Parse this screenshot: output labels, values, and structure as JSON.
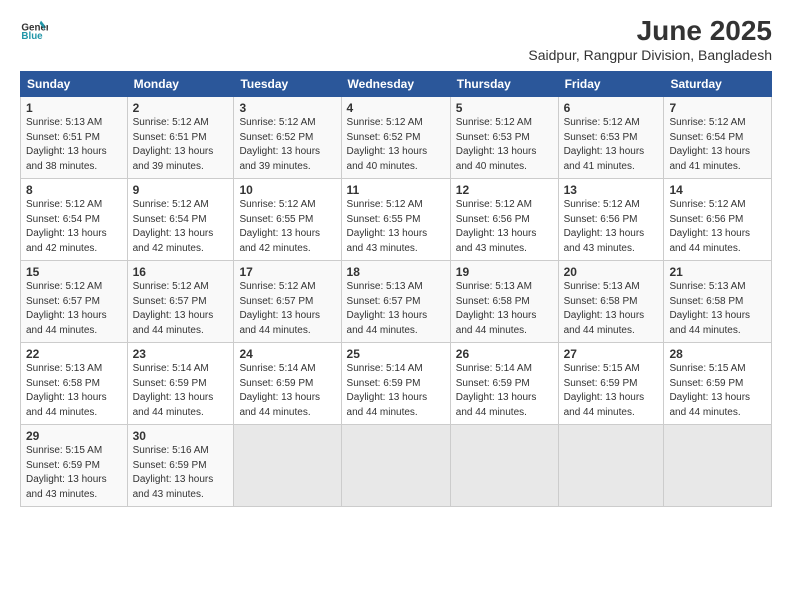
{
  "header": {
    "logo_line1": "General",
    "logo_line2": "Blue",
    "title": "June 2025",
    "subtitle": "Saidpur, Rangpur Division, Bangladesh"
  },
  "calendar": {
    "weekdays": [
      "Sunday",
      "Monday",
      "Tuesday",
      "Wednesday",
      "Thursday",
      "Friday",
      "Saturday"
    ],
    "weeks": [
      [
        {
          "day": "",
          "empty": true
        },
        {
          "day": "",
          "empty": true
        },
        {
          "day": "",
          "empty": true
        },
        {
          "day": "",
          "empty": true
        },
        {
          "day": "",
          "empty": true
        },
        {
          "day": "",
          "empty": true
        },
        {
          "day": "",
          "empty": true
        }
      ],
      [
        {
          "day": "1",
          "sunrise": "5:13 AM",
          "sunset": "6:51 PM",
          "daylight": "13 hours and 38 minutes."
        },
        {
          "day": "2",
          "sunrise": "5:12 AM",
          "sunset": "6:51 PM",
          "daylight": "13 hours and 39 minutes."
        },
        {
          "day": "3",
          "sunrise": "5:12 AM",
          "sunset": "6:52 PM",
          "daylight": "13 hours and 39 minutes."
        },
        {
          "day": "4",
          "sunrise": "5:12 AM",
          "sunset": "6:52 PM",
          "daylight": "13 hours and 40 minutes."
        },
        {
          "day": "5",
          "sunrise": "5:12 AM",
          "sunset": "6:53 PM",
          "daylight": "13 hours and 40 minutes."
        },
        {
          "day": "6",
          "sunrise": "5:12 AM",
          "sunset": "6:53 PM",
          "daylight": "13 hours and 41 minutes."
        },
        {
          "day": "7",
          "sunrise": "5:12 AM",
          "sunset": "6:54 PM",
          "daylight": "13 hours and 41 minutes."
        }
      ],
      [
        {
          "day": "8",
          "sunrise": "5:12 AM",
          "sunset": "6:54 PM",
          "daylight": "13 hours and 42 minutes."
        },
        {
          "day": "9",
          "sunrise": "5:12 AM",
          "sunset": "6:54 PM",
          "daylight": "13 hours and 42 minutes."
        },
        {
          "day": "10",
          "sunrise": "5:12 AM",
          "sunset": "6:55 PM",
          "daylight": "13 hours and 42 minutes."
        },
        {
          "day": "11",
          "sunrise": "5:12 AM",
          "sunset": "6:55 PM",
          "daylight": "13 hours and 43 minutes."
        },
        {
          "day": "12",
          "sunrise": "5:12 AM",
          "sunset": "6:56 PM",
          "daylight": "13 hours and 43 minutes."
        },
        {
          "day": "13",
          "sunrise": "5:12 AM",
          "sunset": "6:56 PM",
          "daylight": "13 hours and 43 minutes."
        },
        {
          "day": "14",
          "sunrise": "5:12 AM",
          "sunset": "6:56 PM",
          "daylight": "13 hours and 44 minutes."
        }
      ],
      [
        {
          "day": "15",
          "sunrise": "5:12 AM",
          "sunset": "6:57 PM",
          "daylight": "13 hours and 44 minutes."
        },
        {
          "day": "16",
          "sunrise": "5:12 AM",
          "sunset": "6:57 PM",
          "daylight": "13 hours and 44 minutes."
        },
        {
          "day": "17",
          "sunrise": "5:12 AM",
          "sunset": "6:57 PM",
          "daylight": "13 hours and 44 minutes."
        },
        {
          "day": "18",
          "sunrise": "5:13 AM",
          "sunset": "6:57 PM",
          "daylight": "13 hours and 44 minutes."
        },
        {
          "day": "19",
          "sunrise": "5:13 AM",
          "sunset": "6:58 PM",
          "daylight": "13 hours and 44 minutes."
        },
        {
          "day": "20",
          "sunrise": "5:13 AM",
          "sunset": "6:58 PM",
          "daylight": "13 hours and 44 minutes."
        },
        {
          "day": "21",
          "sunrise": "5:13 AM",
          "sunset": "6:58 PM",
          "daylight": "13 hours and 44 minutes."
        }
      ],
      [
        {
          "day": "22",
          "sunrise": "5:13 AM",
          "sunset": "6:58 PM",
          "daylight": "13 hours and 44 minutes."
        },
        {
          "day": "23",
          "sunrise": "5:14 AM",
          "sunset": "6:59 PM",
          "daylight": "13 hours and 44 minutes."
        },
        {
          "day": "24",
          "sunrise": "5:14 AM",
          "sunset": "6:59 PM",
          "daylight": "13 hours and 44 minutes."
        },
        {
          "day": "25",
          "sunrise": "5:14 AM",
          "sunset": "6:59 PM",
          "daylight": "13 hours and 44 minutes."
        },
        {
          "day": "26",
          "sunrise": "5:14 AM",
          "sunset": "6:59 PM",
          "daylight": "13 hours and 44 minutes."
        },
        {
          "day": "27",
          "sunrise": "5:15 AM",
          "sunset": "6:59 PM",
          "daylight": "13 hours and 44 minutes."
        },
        {
          "day": "28",
          "sunrise": "5:15 AM",
          "sunset": "6:59 PM",
          "daylight": "13 hours and 44 minutes."
        }
      ],
      [
        {
          "day": "29",
          "sunrise": "5:15 AM",
          "sunset": "6:59 PM",
          "daylight": "13 hours and 43 minutes."
        },
        {
          "day": "30",
          "sunrise": "5:16 AM",
          "sunset": "6:59 PM",
          "daylight": "13 hours and 43 minutes."
        },
        {
          "day": "",
          "empty": true
        },
        {
          "day": "",
          "empty": true
        },
        {
          "day": "",
          "empty": true
        },
        {
          "day": "",
          "empty": true
        },
        {
          "day": "",
          "empty": true
        }
      ]
    ]
  }
}
